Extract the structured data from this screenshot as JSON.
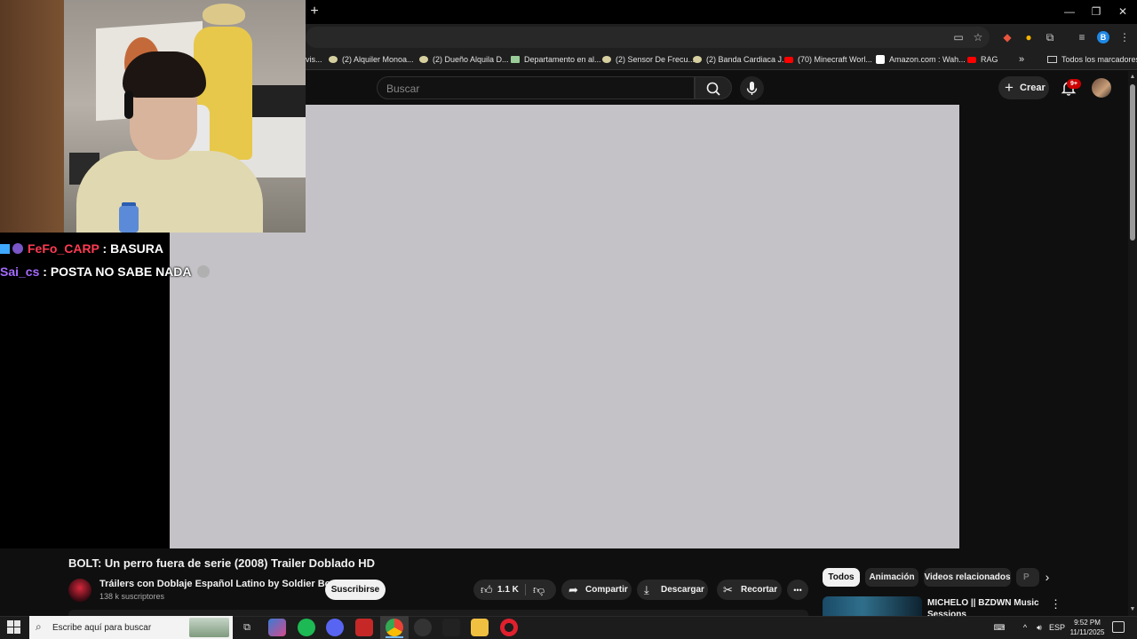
{
  "browser": {
    "new_tab_label": "+",
    "window_controls": [
      "—",
      "❐",
      "✕"
    ],
    "toolbar_icons": [
      "cast-icon",
      "star-icon",
      "extension-icon",
      "extension-icon",
      "puzzle-icon",
      "media-icon",
      "profile-icon",
      "menu-icon"
    ],
    "profile_letter": "B",
    "bookmarks": [
      {
        "label": "vis...",
        "icon": "none"
      },
      {
        "label": "(2) Alquiler Monoa...",
        "icon": "dot"
      },
      {
        "label": "(2) Dueño Alquila D...",
        "icon": "dot"
      },
      {
        "label": "Departamento en al...",
        "icon": "image"
      },
      {
        "label": "(2) Sensor De Frecu...",
        "icon": "dot"
      },
      {
        "label": "(2) Banda Cardiaca J...",
        "icon": "dot"
      },
      {
        "label": "(70) Minecraft Worl...",
        "icon": "youtube"
      },
      {
        "label": "Amazon.com : Wah...",
        "icon": "amazon"
      },
      {
        "label": "RAG",
        "icon": "youtube"
      },
      {
        "label": "»",
        "icon": "none"
      },
      {
        "label": "Todos los marcadores",
        "icon": "folder"
      }
    ]
  },
  "youtube": {
    "search_placeholder": "Buscar",
    "create_label": "Crear",
    "notifications_badge": "9+",
    "video": {
      "title": "BOLT: Un perro fuera de serie (2008) Trailer Doblado HD",
      "channel": "Tráilers con Doblaje Español Latino by Soldier Boy",
      "subscribers": "138 k suscriptores",
      "subscribe_label": "Suscribirse",
      "likes": "1.1 K",
      "share_label": "Compartir",
      "download_label": "Descargar",
      "clip_label": "Recortar",
      "more_label": "•••"
    },
    "chips": [
      "Todos",
      "Animación",
      "Videos relacionados",
      "P"
    ],
    "recommendation": {
      "title": "MICHELO || BZDWN Music Sessions"
    }
  },
  "chat": {
    "messages": [
      {
        "user": "FeFo_CARP",
        "sep": " : ",
        "text": "BASURA",
        "user_color": "#ff3b53"
      },
      {
        "user": "Sai_cs",
        "sep": " : ",
        "text": "POSTA NO SABE NADA",
        "user_color": "#a66bff"
      }
    ]
  },
  "taskbar": {
    "search_placeholder": "Escribe aquí para buscar",
    "language": "ESP",
    "time": "9:52 PM",
    "date": "11/11/2025"
  },
  "colors": {
    "yt_bg": "#0f0f0f",
    "player_bg": "#c4c2c6",
    "chip_active": "#f1f1f1",
    "notification_red": "#cc0000"
  }
}
